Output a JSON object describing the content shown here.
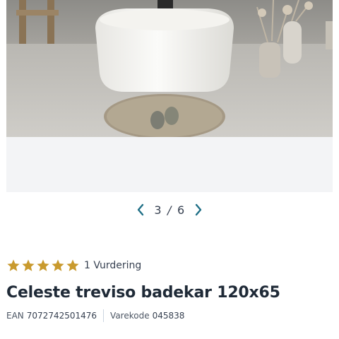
{
  "gallery": {
    "current": "3",
    "separator": "/",
    "total": "6",
    "prev_icon": "chevron-left-icon",
    "next_icon": "chevron-right-icon",
    "image_alt": "Celeste treviso badekar 120x65"
  },
  "rating": {
    "stars": 5,
    "max_stars": 5,
    "label": "1 Vurdering",
    "star_color": "#c99a2e"
  },
  "product": {
    "title": "Celeste treviso badekar 120x65",
    "ean_label": "EAN",
    "ean_value": "7072742501476",
    "sku_label": "Varekode",
    "sku_value": "045838"
  },
  "colors": {
    "accent": "#1f6f86",
    "text": "#1f2a37"
  }
}
